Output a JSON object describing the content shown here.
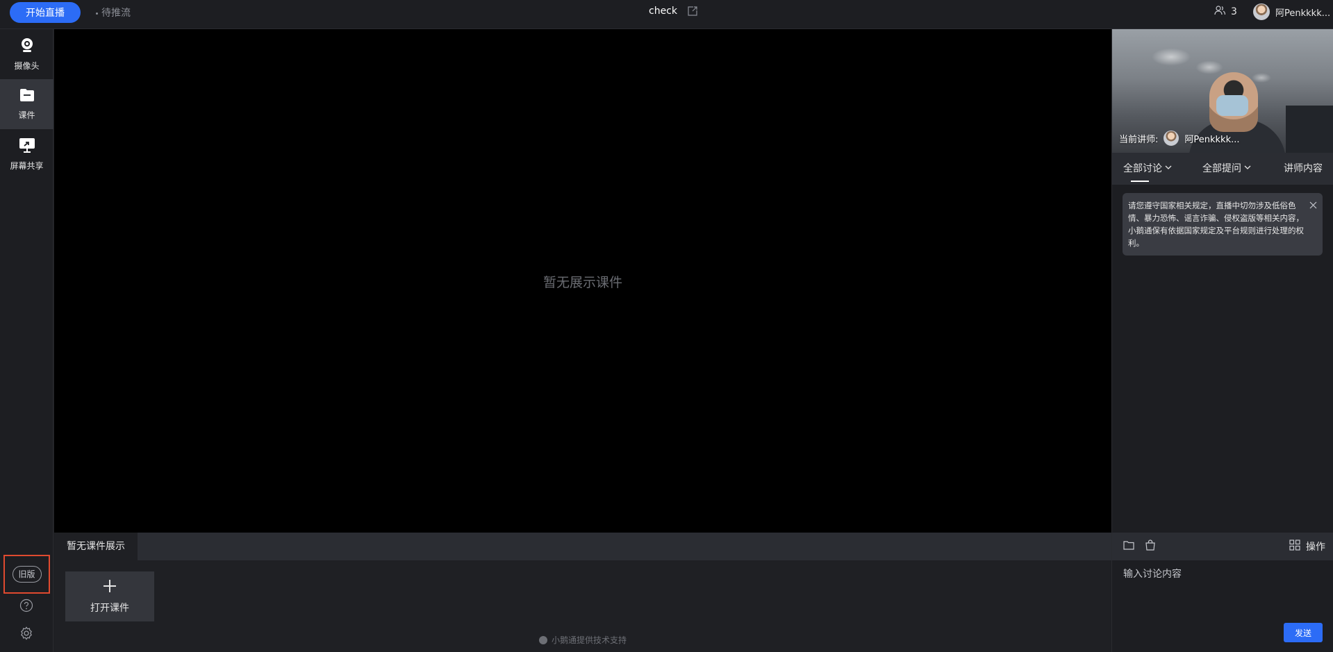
{
  "topbar": {
    "start_live_label": "开始直播",
    "push_status": "待推流",
    "room_title": "check",
    "viewer_count": "3",
    "username": "阿Penkkkk..."
  },
  "sidebar": {
    "items": [
      {
        "label": "摄像头",
        "icon": "camera-icon"
      },
      {
        "label": "课件",
        "icon": "folder-icon"
      },
      {
        "label": "屏幕共享",
        "icon": "screen-share-icon"
      }
    ],
    "active_index": 1,
    "old_version_label": "旧版"
  },
  "stage": {
    "empty_text": "暂无展示课件"
  },
  "courseware": {
    "tab_label": "暂无课件展示",
    "open_label": "打开课件",
    "powered_by": "小鹅通提供技术支持"
  },
  "right_panel": {
    "camera_caption_prefix": "当前讲师:",
    "lecturer_name": "阿Penkkkk...",
    "tabs": [
      {
        "label": "全部讨论"
      },
      {
        "label": "全部提问"
      },
      {
        "label": "讲师内容"
      }
    ],
    "notice": "请您遵守国家相关规定，直播中切勿涉及低俗色情、暴力恐怖、谣言诈骗、侵权盗版等相关内容，小鹅通保有依据国家规定及平台规则进行处理的权利。",
    "operations_label": "操作",
    "input_placeholder": "输入讨论内容",
    "send_label": "发送"
  },
  "colors": {
    "accent": "#2c6cf6",
    "highlight_border": "#e04a2f",
    "background": "#1f2024",
    "stage": "#000000"
  }
}
